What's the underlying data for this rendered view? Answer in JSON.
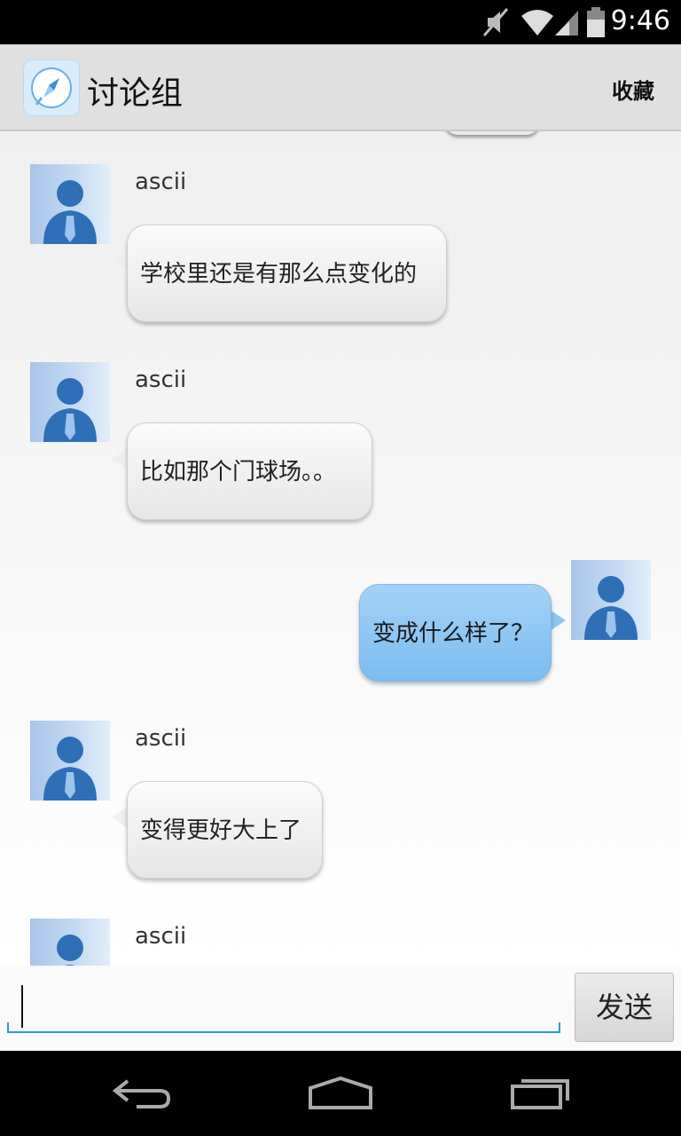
{
  "status_bar": {
    "time": "9:46"
  },
  "action_bar": {
    "title": "讨论组",
    "favorite_label": "收藏"
  },
  "messages": [
    {
      "sender": "ascii",
      "text": "学校里还是有那么点变化的",
      "outgoing": false
    },
    {
      "sender": "ascii",
      "text": "比如那个门球场。。",
      "outgoing": false
    },
    {
      "text": "变成什么样了？",
      "outgoing": true
    },
    {
      "sender": "ascii",
      "text": "变得更好大上了",
      "outgoing": false
    },
    {
      "sender": "ascii",
      "outgoing": false
    }
  ],
  "input": {
    "value": "",
    "placeholder": ""
  },
  "send_button": {
    "label": "发送"
  },
  "colors": {
    "accent": "#2a9ad6",
    "outgoing_bubble": "#8cc6f2",
    "action_bar": "#e0e0e0"
  },
  "icons": [
    "mute-icon",
    "wifi-icon",
    "signal-icon",
    "battery-icon",
    "compass-app-icon",
    "back-icon",
    "home-icon",
    "recent-apps-icon"
  ]
}
